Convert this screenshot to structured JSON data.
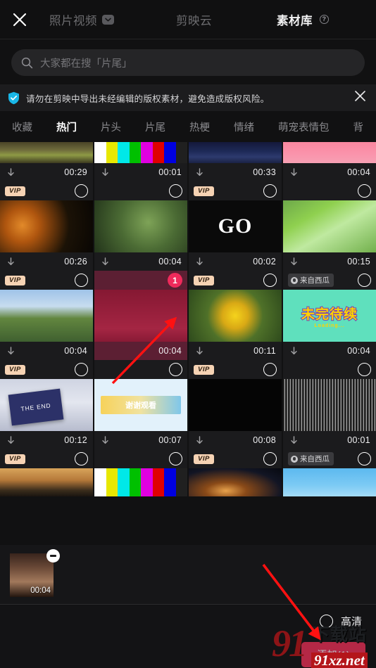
{
  "header": {
    "close_icon": "close-icon",
    "tabs": [
      {
        "label": "照片视频",
        "has_caret": true,
        "active": false
      },
      {
        "label": "剪映云",
        "has_caret": false,
        "active": false
      },
      {
        "label": "素材库",
        "has_help": true,
        "active": true
      }
    ]
  },
  "search": {
    "placeholder": "大家都在搜「片尾」",
    "icon": "search-icon"
  },
  "banner": {
    "icon": "shield-check-icon",
    "text": "请勿在剪映中导出未经编辑的版权素材，避免造成版权风险。",
    "close_icon": "close-icon"
  },
  "categories": [
    {
      "label": "收藏",
      "active": false
    },
    {
      "label": "热门",
      "active": true
    },
    {
      "label": "片头",
      "active": false
    },
    {
      "label": "片尾",
      "active": false
    },
    {
      "label": "热梗",
      "active": false
    },
    {
      "label": "情绪",
      "active": false
    },
    {
      "label": "萌宠表情包",
      "active": false
    },
    {
      "label": "背",
      "active": false
    }
  ],
  "grid": {
    "vip_label": "VIP",
    "source_label": "来自西瓜",
    "items": [
      {
        "id": "r1c1",
        "duration": "00:29",
        "badge": "none",
        "thumb": "t-forest",
        "selected": false,
        "row": 1
      },
      {
        "id": "r1c2",
        "duration": "00:01",
        "badge": "none",
        "thumb": "t-colorbar",
        "selected": false,
        "row": 1
      },
      {
        "id": "r1c3",
        "duration": "00:33",
        "badge": "none",
        "thumb": "t-ocean",
        "selected": false,
        "row": 1
      },
      {
        "id": "r1c4",
        "duration": "00:04",
        "badge": "none",
        "thumb": "t-pink",
        "selected": false,
        "row": 1
      },
      {
        "id": "r2c1",
        "duration": "00:26",
        "badge": "vip",
        "thumb": "t-sparks",
        "selected": false,
        "row": 2
      },
      {
        "id": "r2c2",
        "duration": "00:04",
        "badge": "none",
        "thumb": "t-bell",
        "selected": false,
        "row": 2
      },
      {
        "id": "r2c3",
        "duration": "00:02",
        "badge": "vip",
        "thumb": "t-go",
        "selected": false,
        "row": 2,
        "overlay_text": "GO"
      },
      {
        "id": "r2c4",
        "duration": "00:15",
        "badge": "none",
        "thumb": "t-leaves",
        "selected": false,
        "row": 2
      },
      {
        "id": "r3c1",
        "duration": "00:04",
        "badge": "vip",
        "thumb": "t-hill",
        "selected": false,
        "row": 3
      },
      {
        "id": "r3c2",
        "duration": "00:04",
        "badge": "none",
        "thumb": "t-man",
        "selected": true,
        "row": 3,
        "select_number": "1"
      },
      {
        "id": "r3c3",
        "duration": "00:11",
        "badge": "vip",
        "thumb": "t-flower",
        "selected": false,
        "row": 3
      },
      {
        "id": "r3c4",
        "duration": "00:04",
        "badge": "src",
        "thumb": "t-mint",
        "selected": false,
        "row": 3,
        "overlay_text": "未完待续",
        "overlay_sub": "Loading..."
      },
      {
        "id": "r4c1",
        "duration": "00:12",
        "badge": "vip",
        "thumb": "t-clap",
        "selected": false,
        "row": 4,
        "overlay_text": "THE END"
      },
      {
        "id": "r4c2",
        "duration": "00:07",
        "badge": "none",
        "thumb": "t-blue",
        "selected": false,
        "row": 4,
        "overlay_text": "谢谢观看"
      },
      {
        "id": "r4c3",
        "duration": "00:08",
        "badge": "vip",
        "thumb": "t-rain",
        "selected": false,
        "row": 4
      },
      {
        "id": "r4c4",
        "duration": "00:01",
        "badge": "none",
        "thumb": "t-static",
        "selected": false,
        "row": 4
      },
      {
        "id": "r5c1",
        "duration": "",
        "badge": "vip",
        "thumb": "t-dusk",
        "selected": false,
        "row": 5
      },
      {
        "id": "r5c2",
        "duration": "",
        "badge": "none",
        "thumb": "t-bars2",
        "selected": false,
        "row": 5
      },
      {
        "id": "r5c3",
        "duration": "",
        "badge": "vip",
        "thumb": "t-city",
        "selected": false,
        "row": 5
      },
      {
        "id": "r5c4",
        "duration": "",
        "badge": "src",
        "thumb": "t-sky",
        "selected": false,
        "row": 5
      }
    ]
  },
  "tray": {
    "items": [
      {
        "duration": "00:04",
        "remove_icon": "minus-icon"
      }
    ]
  },
  "footer": {
    "hd_label": "高清",
    "hd_selected": false,
    "add_label": "添加(1)",
    "accent_color": "#f2315a"
  },
  "watermark": {
    "logo_num": "91",
    "logo_cn": "下载站",
    "url": "91xz.net"
  },
  "annotations": {
    "arrow_color": "#ff1111",
    "arrows": [
      {
        "name": "arrow-to-selected-card",
        "from": [
          160,
          545
        ],
        "to": [
          247,
          455
        ]
      },
      {
        "name": "arrow-to-add-button",
        "from": [
          372,
          803
        ],
        "to": [
          453,
          908
        ]
      }
    ]
  }
}
